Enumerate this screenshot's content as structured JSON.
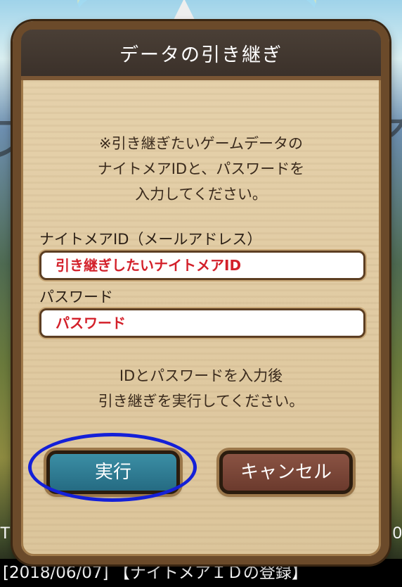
{
  "dialog": {
    "title": "データの引き継ぎ",
    "instructions": [
      "※引き継ぎたいゲームデータの",
      "ナイトメアIDと、パスワードを",
      "入力してください。"
    ],
    "id_field": {
      "label": "ナイトメアID（メールアドレス）",
      "placeholder": "引き継ぎしたいナイトメアID"
    },
    "password_field": {
      "label": "パスワード",
      "placeholder": "パスワード"
    },
    "note": [
      "IDとパスワードを入力後",
      "引き継ぎを実行してください。"
    ],
    "execute_label": "実行",
    "cancel_label": "キャンセル"
  },
  "background": {
    "left_text": "Ti",
    "right_text": "0",
    "news": "[2018/06/07] 【ナイトメアＩＤの登録】"
  },
  "colors": {
    "title_bar": "#3b312a",
    "panel": "#dcc59b",
    "placeholder_text": "#d3202a",
    "execute_button": "#256b82",
    "cancel_button": "#6b3a2d",
    "highlight": "#1420d8"
  }
}
